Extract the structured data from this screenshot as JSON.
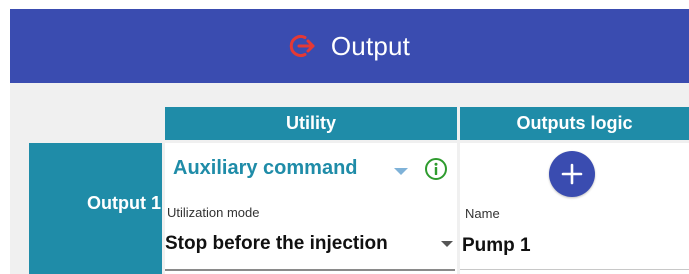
{
  "header": {
    "title": "Output",
    "icon": "logout-icon",
    "background": "#3a4cb0",
    "icon_color": "#e53935"
  },
  "table": {
    "columns": {
      "utility": "Utility",
      "outputs_logic": "Outputs logic"
    },
    "rows": [
      {
        "label": "Output 1",
        "utility": {
          "command": "Auxiliary command",
          "mode_label": "Utilization mode",
          "mode_value": "Stop before the injection"
        },
        "logic": {
          "add_icon": "plus-icon",
          "name_label": "Name",
          "name_value": "Pump 1"
        }
      }
    ]
  },
  "colors": {
    "teal": "#1f8ca8",
    "info_green": "#2e9b2e",
    "panel_bg": "#f0f0f0"
  }
}
